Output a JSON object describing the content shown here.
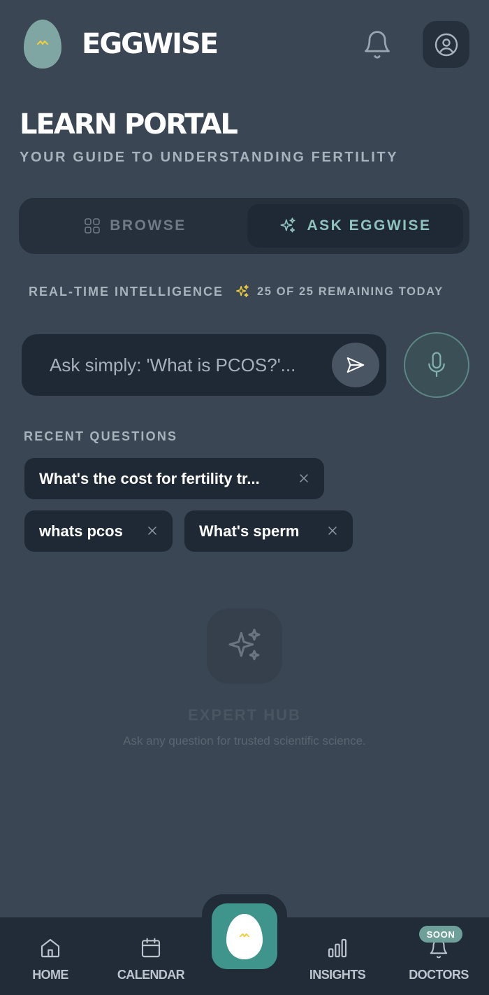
{
  "app": {
    "brand": "EGGWISE"
  },
  "header": {
    "title": "LEARN PORTAL",
    "subtitle": "YOUR GUIDE TO UNDERSTANDING FERTILITY"
  },
  "tabs": [
    {
      "label": "BROWSE",
      "active": false
    },
    {
      "label": "ASK EGGWISE",
      "active": true
    }
  ],
  "status": {
    "left": "REAL-TIME INTELLIGENCE",
    "right": "25 OF 25 REMAINING TODAY"
  },
  "ask": {
    "placeholder": "Ask simply: 'What is PCOS?'..."
  },
  "recent": {
    "label": "RECENT QUESTIONS",
    "items": [
      "What's the cost for fertility tr...",
      "whats pcos",
      "What's sperm"
    ]
  },
  "hub": {
    "title": "EXPERT HUB",
    "description": "Ask any question for trusted scientific science."
  },
  "nav": {
    "items": [
      {
        "label": "HOME",
        "icon": "home-icon"
      },
      {
        "label": "CALENDAR",
        "icon": "calendar-icon"
      },
      {
        "label": "INSIGHTS",
        "icon": "bar-chart-icon"
      },
      {
        "label": "DOCTORS",
        "icon": "bell-icon"
      }
    ],
    "badge": "SOON"
  },
  "colors": {
    "background": "#3a4653",
    "surface": "#1f2935",
    "accent": "#8fc3bd",
    "spark": "#f0cf3a",
    "center_button": "#3f958c"
  }
}
